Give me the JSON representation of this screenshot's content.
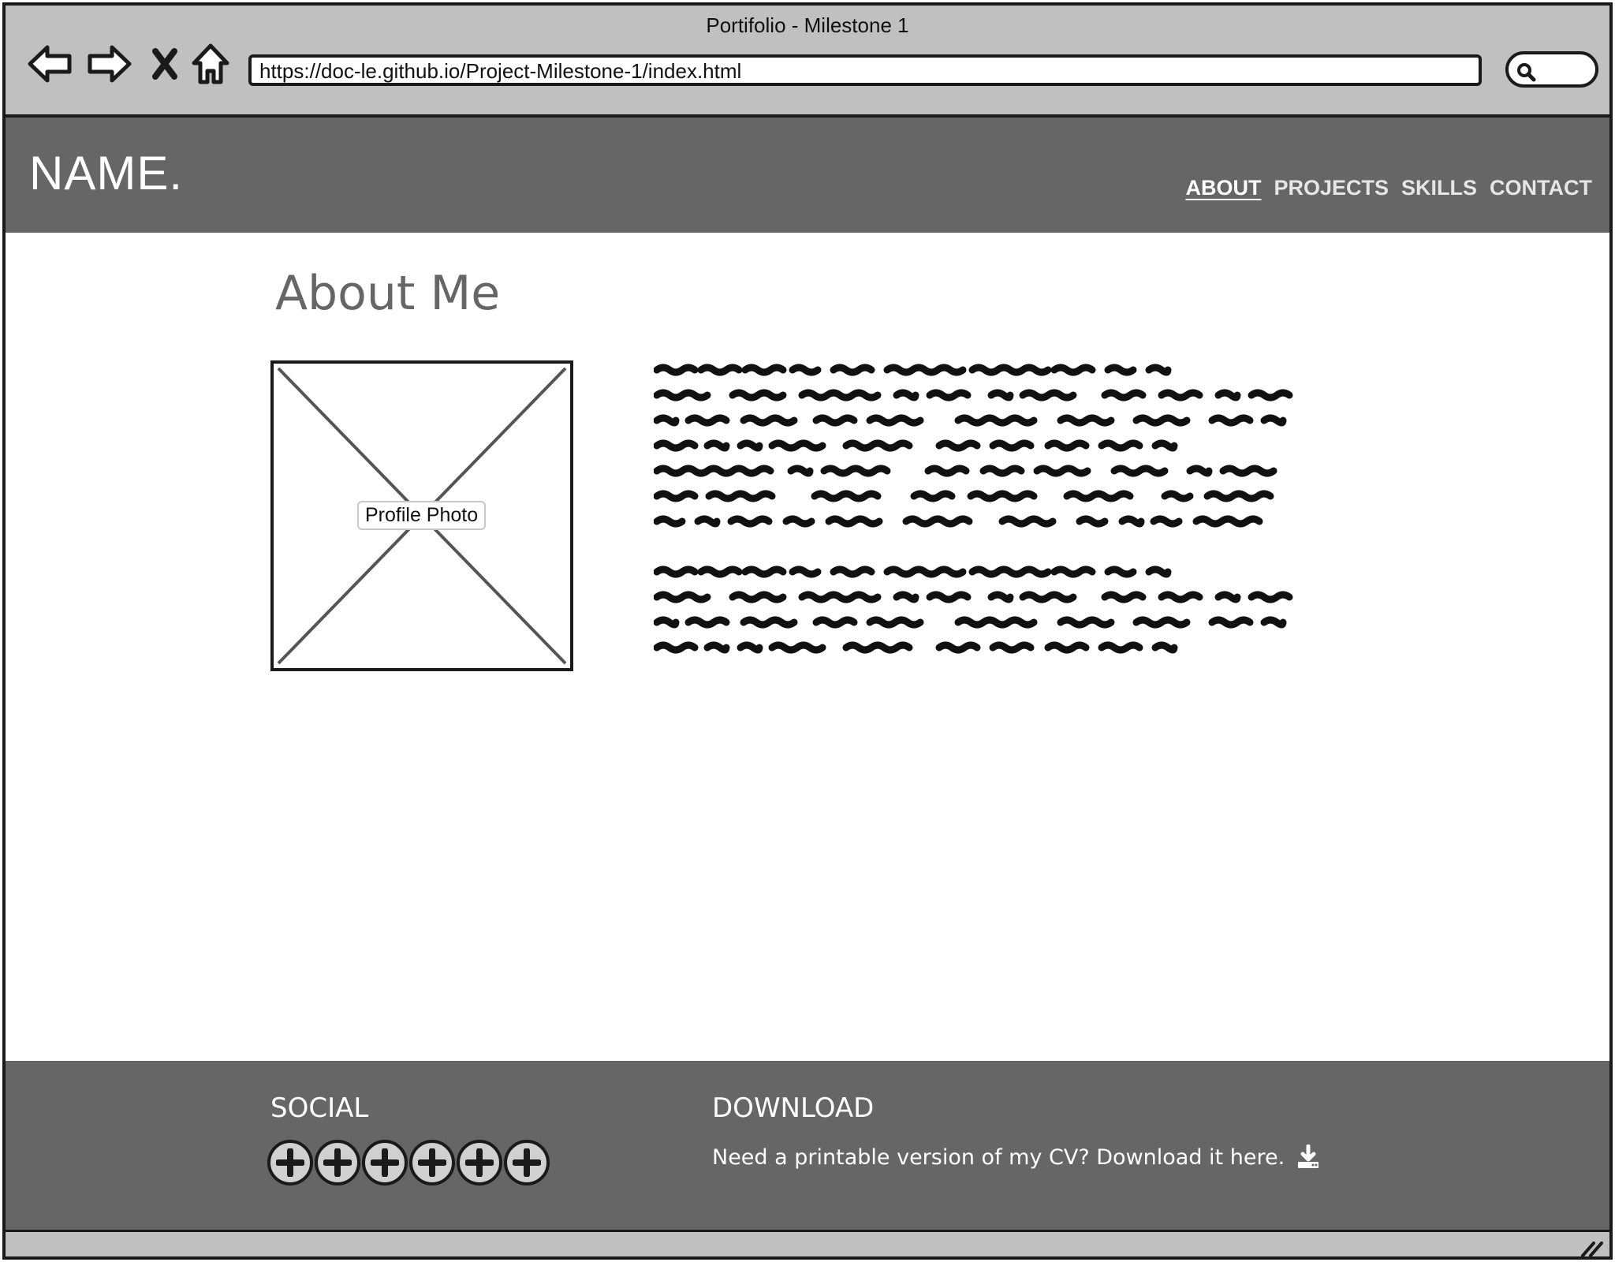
{
  "browser": {
    "window_title": "Portifolio - Milestone 1",
    "url": "https://doc-le.github.io/Project-Milestone-1/index.html",
    "icons": {
      "back": "arrow-left-icon",
      "forward": "arrow-right-icon",
      "stop": "close-icon",
      "home": "home-icon",
      "search": "search-icon"
    }
  },
  "header": {
    "brand": "NAME.",
    "nav": [
      {
        "label": "ABOUT",
        "active": true
      },
      {
        "label": "PROJECTS",
        "active": false
      },
      {
        "label": "SKILLS",
        "active": false
      },
      {
        "label": "CONTACT",
        "active": false
      }
    ]
  },
  "main": {
    "heading": "About Me",
    "photo_label": "Profile Photo"
  },
  "footer": {
    "social_heading": "SOCIAL",
    "social_icon": "plus-circle-icon",
    "download_heading": "DOWNLOAD",
    "download_text": "Need a printable version of my CV? Download it here.",
    "download_icon": "download-icon"
  },
  "colors": {
    "header_bg": "#666666",
    "footer_bg": "#666666",
    "chrome_bg": "#c0c0c0",
    "heading_text": "#666666"
  }
}
